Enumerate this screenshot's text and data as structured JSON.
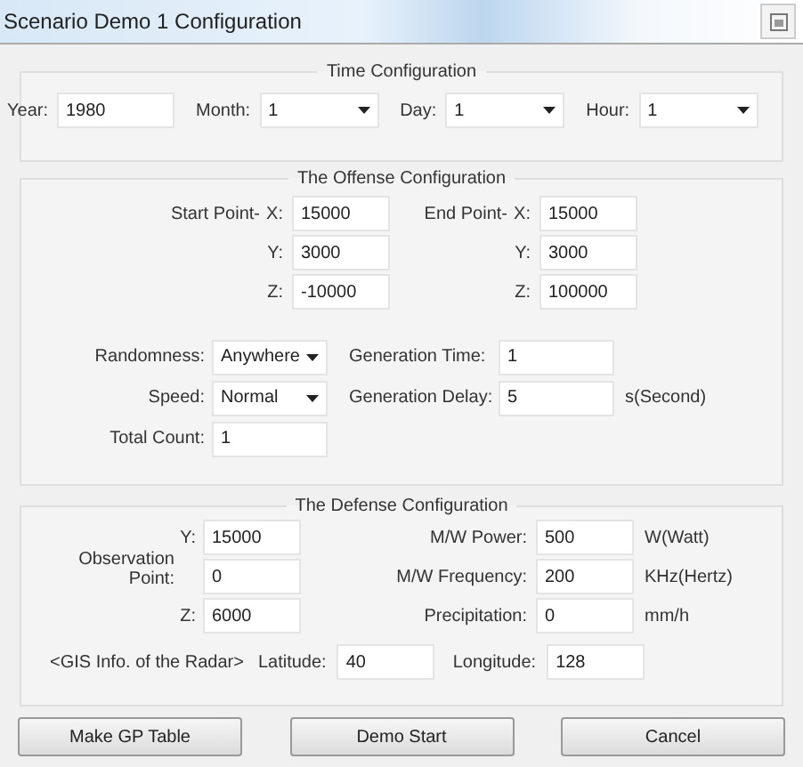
{
  "window": {
    "title": "Scenario Demo 1 Configuration"
  },
  "time": {
    "title": "Time Configuration",
    "fields": [
      {
        "kind": "text",
        "label": "Year:",
        "value": "1980"
      },
      {
        "kind": "select",
        "label": "Month:",
        "value": "1"
      },
      {
        "kind": "select",
        "label": "Day:",
        "value": "1"
      },
      {
        "kind": "select",
        "label": "Hour:",
        "value": "1"
      }
    ]
  },
  "offense": {
    "title": "The Offense Configuration",
    "points": [
      {
        "label": "Start Point-",
        "coords": [
          {
            "axis": "X:",
            "value": "15000"
          },
          {
            "axis": "Y:",
            "value": "3000"
          },
          {
            "axis": "Z:",
            "value": "-10000"
          }
        ]
      },
      {
        "label": "End Point-",
        "coords": [
          {
            "axis": "X:",
            "value": "15000"
          },
          {
            "axis": "Y:",
            "value": "3000"
          },
          {
            "axis": "Z:",
            "value": "100000"
          }
        ]
      }
    ],
    "left": [
      {
        "kind": "select",
        "label": "Randomness:",
        "value": "Anywhere"
      },
      {
        "kind": "select",
        "label": "Speed:",
        "value": "Normal"
      },
      {
        "kind": "text",
        "label": "Total Count:",
        "value": "1"
      }
    ],
    "right": [
      {
        "label": "Generation Time:",
        "value": "1"
      },
      {
        "label": "Generation Delay:",
        "value": "5",
        "unit": "s(Second)"
      }
    ]
  },
  "defense": {
    "title": "The Defense Configuration",
    "observation": {
      "label": "Observation Point:",
      "rows": [
        {
          "label": "Y:",
          "value": "15000"
        },
        {
          "value": "0"
        },
        {
          "label": "Z:",
          "value": "6000"
        }
      ]
    },
    "radar": [
      {
        "label": "M/W Power:",
        "value": "500",
        "unit": "W(Watt)"
      },
      {
        "label": "M/W Frequency:",
        "value": "200",
        "unit": "KHz(Hertz)"
      },
      {
        "label": "Precipitation:",
        "value": "0",
        "unit": "mm/h"
      }
    ],
    "gis": {
      "label": "<GIS Info. of the Radar>",
      "latitude": {
        "label": "Latitude:",
        "value": "40"
      },
      "longitude": {
        "label": "Longitude:",
        "value": "128"
      }
    }
  },
  "buttons": [
    "Make GP Table",
    "Demo Start",
    "Cancel"
  ]
}
